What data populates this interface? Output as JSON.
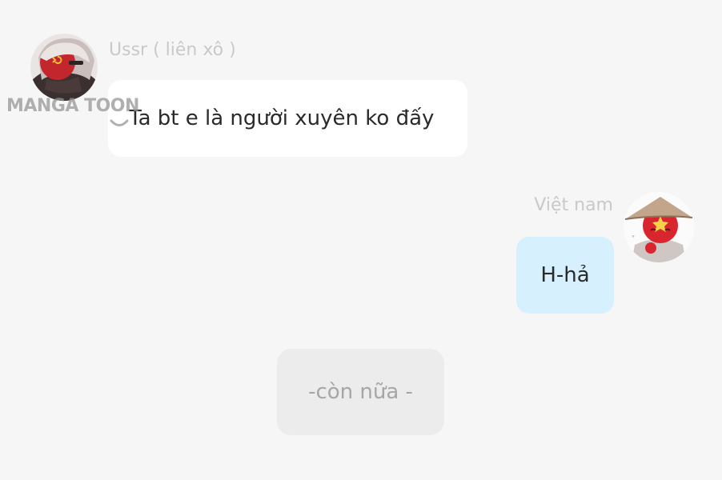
{
  "watermark": {
    "text": "MANGA TOON"
  },
  "messages": [
    {
      "side": "left",
      "sender": "Ussr ( liên xô )",
      "avatar_icon": "ussr-character-avatar-icon",
      "text": "Ta bt e là người xuyên ko đấy",
      "bubble_color": "#ffffff"
    },
    {
      "side": "right",
      "sender": "Việt nam",
      "avatar_icon": "vietnam-character-avatar-icon",
      "text": "H-hả",
      "bubble_color": "#d6f0fd"
    }
  ],
  "continue_label": "-còn nữa -"
}
